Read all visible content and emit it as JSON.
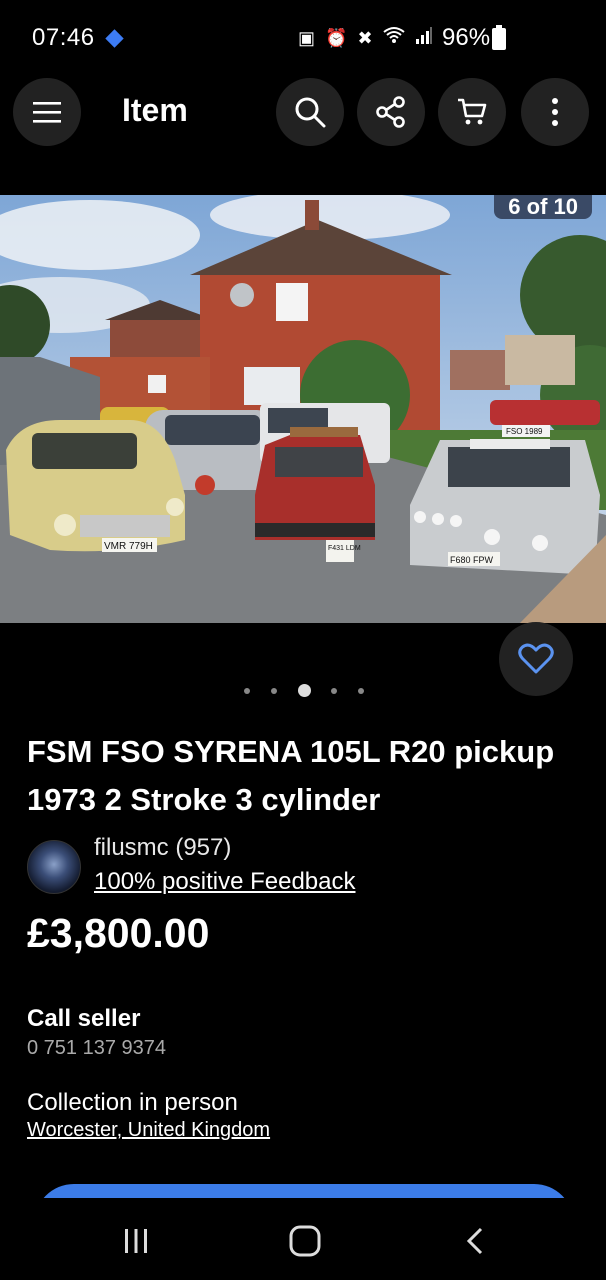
{
  "status_bar": {
    "time": "07:46",
    "battery": "96%",
    "icons": [
      "lock-badge-icon",
      "alarm-icon",
      "mute-icon",
      "wifi-icon",
      "signal-icon",
      "battery-icon"
    ]
  },
  "app_bar": {
    "title": "Item",
    "icons": [
      "menu-icon",
      "search-icon",
      "share-icon",
      "cart-icon",
      "more-icon"
    ]
  },
  "gallery": {
    "counter": "6 of 10",
    "current_index": 3,
    "dot_count": 5,
    "license_plates": [
      "VMR 779H",
      "F431 LDM",
      "F680 FPW",
      "FSO 1989"
    ]
  },
  "listing": {
    "title": "FSM FSO SYRENA 105L R20 pickup 1973 2 Stroke 3 cylinder",
    "price": "£3,800.00"
  },
  "seller": {
    "name": "filusmc (957)",
    "feedback": "100% positive Feedback"
  },
  "contact": {
    "label": "Call seller",
    "phone": "0 751 137 9374"
  },
  "delivery": {
    "label": "Collection in person",
    "location": "Worcester, United Kingdom"
  },
  "colors": {
    "accent": "#3c7ce8",
    "heart": "#5b93f0",
    "button_bg": "#222222"
  }
}
